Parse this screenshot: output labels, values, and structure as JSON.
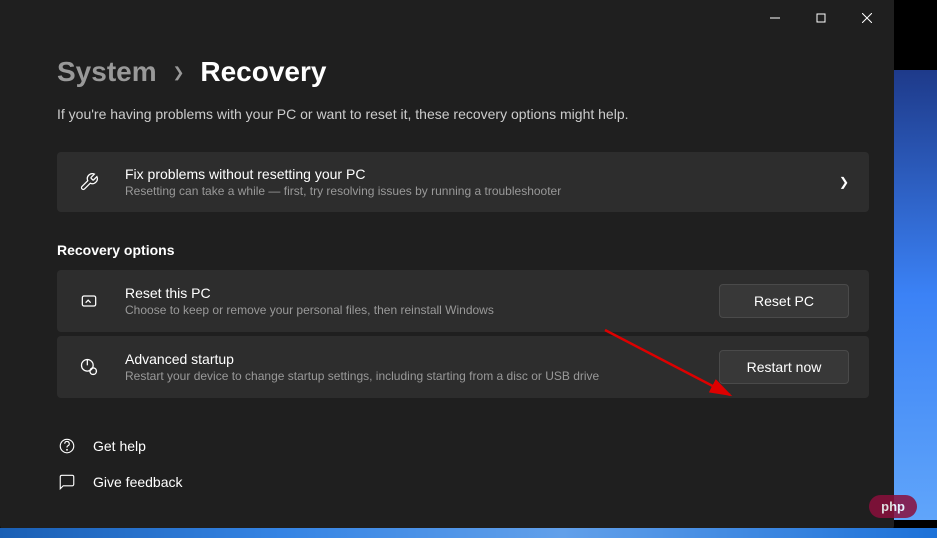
{
  "breadcrumb": {
    "parent": "System",
    "current": "Recovery"
  },
  "subtitle": "If you're having problems with your PC or want to reset it, these recovery options might help.",
  "troubleshoot_card": {
    "title": "Fix problems without resetting your PC",
    "desc": "Resetting can take a while — first, try resolving issues by running a troubleshooter"
  },
  "section_header": "Recovery options",
  "reset_card": {
    "title": "Reset this PC",
    "desc": "Choose to keep or remove your personal files, then reinstall Windows",
    "button": "Reset PC"
  },
  "advanced_card": {
    "title": "Advanced startup",
    "desc": "Restart your device to change startup settings, including starting from a disc or USB drive",
    "button": "Restart now"
  },
  "links": {
    "help": "Get help",
    "feedback": "Give feedback"
  },
  "watermark": "php"
}
